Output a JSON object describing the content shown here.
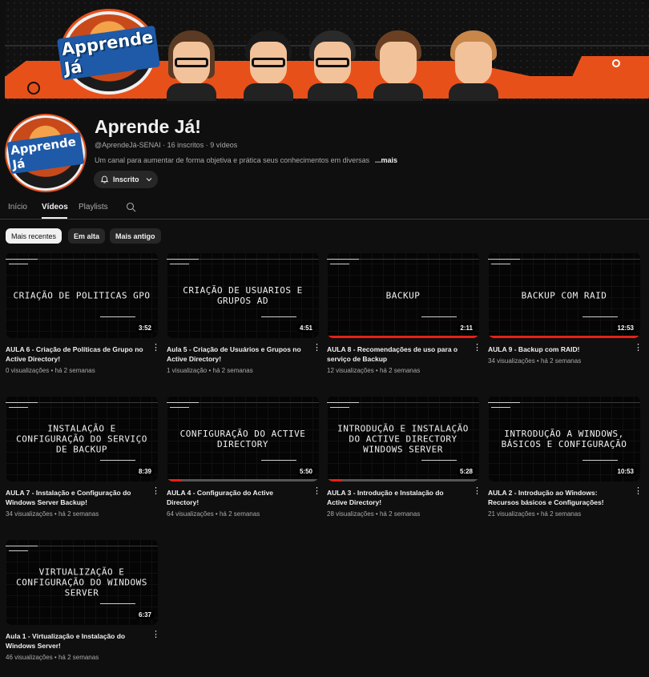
{
  "banner": {
    "logo_text": "Apprende Já"
  },
  "channel": {
    "avatar_text": "Apprende Já",
    "name": "Aprende Já!",
    "meta": "@AprendeJá-SENAI · 16 inscritos · 9 vídeos",
    "description": "Um canal para aumentar de forma objetiva e prática seus conhecimentos em diversas",
    "more": "...mais",
    "subscribe_label": "Inscrito"
  },
  "tabs": [
    {
      "label": "Início"
    },
    {
      "label": "Vídeos"
    },
    {
      "label": "Playlists"
    }
  ],
  "filters": [
    {
      "label": "Mais recentes"
    },
    {
      "label": "Em alta"
    },
    {
      "label": "Mais antigo"
    }
  ],
  "videos": [
    {
      "thumb_text": "Criação de politicas GPO",
      "duration": "3:52",
      "title": "AULA 6 - Criação de Políticas de Grupo no Active Directory!",
      "meta": "0 visualizações • há 2 semanas",
      "progress": 0
    },
    {
      "thumb_text": "Criação de usuarios e grupos AD",
      "duration": "4:51",
      "title": "Aula 5 - Criação de Usuários e Grupos no Active Directory!",
      "meta": "1 visualização • há 2 semanas",
      "progress": 0
    },
    {
      "thumb_text": "Backup",
      "duration": "2:11",
      "title": "AULA 8 - Recomendações de uso para o serviço de Backup",
      "meta": "12 visualizações • há 2 semanas",
      "progress": 1.0
    },
    {
      "thumb_text": "Backup com RAID",
      "duration": "12:53",
      "title": "AULA 9 - Backup com RAID!",
      "meta": "34 visualizações • há 2 semanas",
      "progress": 1.0
    },
    {
      "thumb_text": "Instalação e configuração do serviço de backup",
      "duration": "8:39",
      "title": "AULA 7 - Instalação e Configuração do Windows Server Backup!",
      "meta": "34 visualizações • há 2 semanas",
      "progress": 0
    },
    {
      "thumb_text": "Configuração do Active Directory",
      "duration": "5:50",
      "title": "AULA 4 - Configuração do Active Directory!",
      "meta": "64 visualizações • há 2 semanas",
      "progress": 0.1
    },
    {
      "thumb_text": "Introdução e instalação do Active Directory Windows Server",
      "duration": "5:28",
      "title": "AULA 3 - Introdução e Instalação do Active Directory!",
      "meta": "28 visualizações • há 2 semanas",
      "progress": 0.1
    },
    {
      "thumb_text": "Introdução a windows, básicos e configuração",
      "duration": "10:53",
      "title": "AULA 2 - Introdução ao Windows: Recursos básicos e Configurações!",
      "meta": "21 visualizações • há 2 semanas",
      "progress": 0
    },
    {
      "thumb_text": "Virtualização e configuração do windows server",
      "duration": "6:37",
      "title": "Aula 1 - Virtualização e Instalação do Windows Server!",
      "meta": "46 visualizações • há 2 semanas",
      "progress": 0
    }
  ],
  "colors": {
    "accent": "#e8501a",
    "progress": "#e62117",
    "background": "#0f0f0f"
  },
  "icons": {
    "subscribe": "bell-icon",
    "dropdown": "chevron-down-icon",
    "search": "search-icon",
    "menu": "kebab-menu-icon"
  }
}
